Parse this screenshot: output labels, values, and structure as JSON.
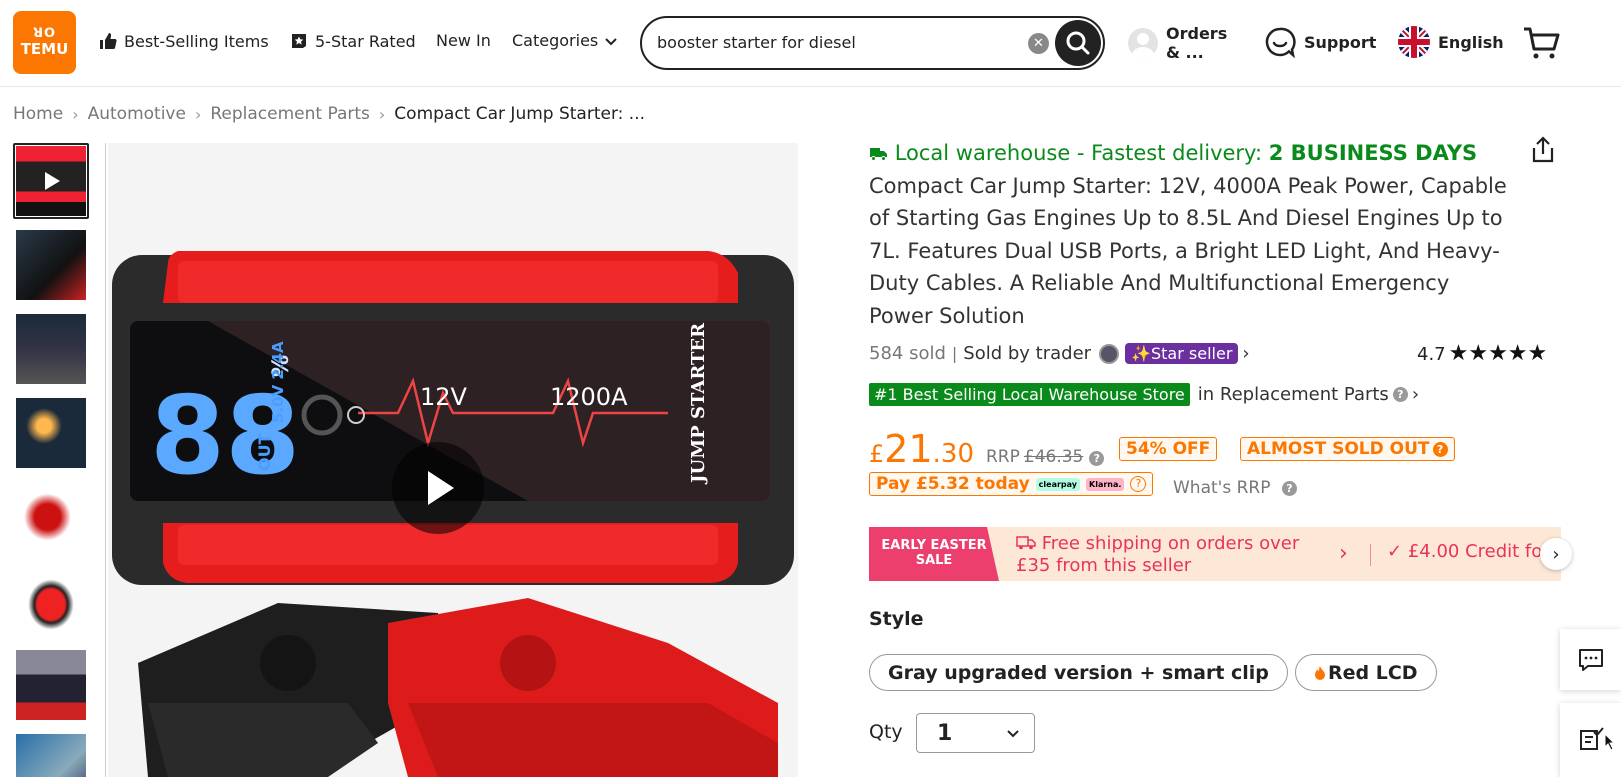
{
  "header": {
    "logo_text": "TEMU",
    "logo_glyphs": "ꓤꓳ",
    "nav": {
      "best_selling": "Best-Selling Items",
      "five_star": "5-Star Rated",
      "new_in": "New In",
      "categories": "Categories"
    },
    "search": {
      "value": "booster starter for diesel"
    },
    "orders_label": "Orders & ...",
    "support_label": "Support",
    "language_label": "English"
  },
  "breadcrumb": [
    "Home",
    "Automotive",
    "Replacement Parts",
    "Compact Car Jump Starter: ..."
  ],
  "product": {
    "delivery_prefix": "Local warehouse - Fastest delivery:",
    "delivery_days": "2 BUSINESS DAYS",
    "title": "Compact Car Jump Starter: 12V, 4000A Peak Power, Capable of Starting Gas Engines Up to 8.5L And Diesel Engines Up to 7L. Features Dual USB Ports, a Bright LED Light, And Heavy-Duty Cables. A Reliable And Multifunctional Emergency Power Solution",
    "sold": "584 sold",
    "sold_sep": "|",
    "sold_by": "Sold by trader",
    "star_seller": "Star seller",
    "rating": "4.7",
    "rating_value": 4.7,
    "best_badge": "#1 Best Selling Local Warehouse Store",
    "best_category": "in Replacement Parts",
    "price_currency": "£",
    "price_main": "21",
    "price_decimal": ".30",
    "rrp_label": "RRP",
    "rrp_value": "£46.35",
    "discount": "54% OFF",
    "stock_status": "ALMOST SOLD OUT",
    "pay_today": "Pay £5.32 today",
    "pay_logo_1": "clearpay",
    "pay_logo_2": "Klarna.",
    "whats_rrp": "What's RRP"
  },
  "banner": {
    "tag": "EARLY EASTER SALE",
    "shipping": "Free shipping on orders over £35 from this seller",
    "credit": "£4.00 Credit fo"
  },
  "options": {
    "style_label": "Style",
    "choices": [
      "Gray upgraded version + smart clip",
      "Red LCD"
    ],
    "qty_label": "Qty",
    "qty_value": "1"
  },
  "media": {
    "screen_voltage": "12V",
    "screen_current": "1200A",
    "screen_digits": "88",
    "screen_percent": "%",
    "screen_out": "OUT",
    "screen_usb": "5.0V 2.4A",
    "device_label": "JUMP STARTER"
  },
  "colors": {
    "brand_orange": "#fb7701",
    "delivery_green": "#0a8a1a",
    "star_seller_purple": "#6b2fa0",
    "banner_pink": "#ec3f6e",
    "banner_bg": "#fde8d6"
  },
  "icons": [
    "thumbs-up-icon",
    "star-badge-icon",
    "chevron-down-icon",
    "clear-icon",
    "search-icon",
    "avatar-icon",
    "support-icon",
    "uk-flag-icon",
    "cart-icon",
    "truck-icon",
    "share-icon",
    "play-icon",
    "chat-icon",
    "checklist-icon",
    "cursor-icon"
  ]
}
